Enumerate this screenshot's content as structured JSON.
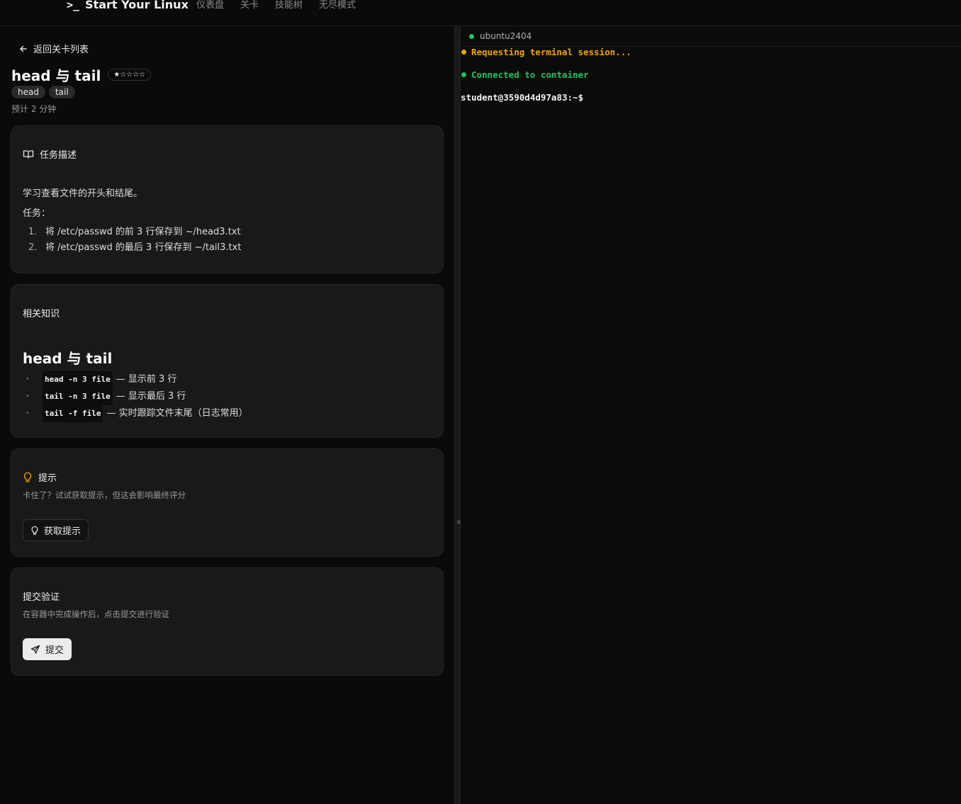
{
  "app": {
    "brand": "Start Your Linux",
    "brand_icon": "terminal-prompt-icon",
    "nav": [
      "仪表盘",
      "关卡",
      "技能树",
      "无尽模式"
    ]
  },
  "level": {
    "back_label": "返回关卡列表",
    "title": "head 与 tail",
    "difficulty_stars": "★☆☆☆☆",
    "difficulty": 1,
    "difficulty_max": 5,
    "tags": [
      "head",
      "tail"
    ],
    "eta": "预计 2 分钟"
  },
  "task_card": {
    "title": "任务描述",
    "icon": "book-open-icon",
    "description": "学习查看文件的开头和结尾。",
    "label": "任务：",
    "items": [
      "将 /etc/passwd 的前 3 行保存到 ~/head3.txt",
      "将 /etc/passwd 的最后 3 行保存到 ~/tail3.txt"
    ]
  },
  "knowledge_card": {
    "title": "相关知识",
    "heading": "head 与 tail",
    "items": [
      {
        "code": "head -n 3 file",
        "text": "— 显示前 3 行"
      },
      {
        "code": "tail -n 3 file",
        "text": "— 显示最后 3 行"
      },
      {
        "code": "tail -f file",
        "text": "— 实时跟踪文件末尾（日志常用）"
      }
    ]
  },
  "hint_card": {
    "title": "提示",
    "icon": "lightbulb-icon",
    "subtitle": "卡住了？试试获取提示，但这会影响最终评分",
    "button_label": "获取提示"
  },
  "submit_card": {
    "title": "提交验证",
    "subtitle": "在容器中完成操作后，点击提交进行验证",
    "button_label": "提交",
    "button_icon": "send-icon"
  },
  "terminal": {
    "tab_label": "ubuntu2404",
    "tab_status_color": "#22c55e",
    "lines": [
      {
        "text": "Requesting terminal session...",
        "color": "#f0a500"
      },
      {
        "text": "Connected to container",
        "color": "#22c55e"
      }
    ],
    "prompt": "student@3590d4d97a83:~$"
  }
}
